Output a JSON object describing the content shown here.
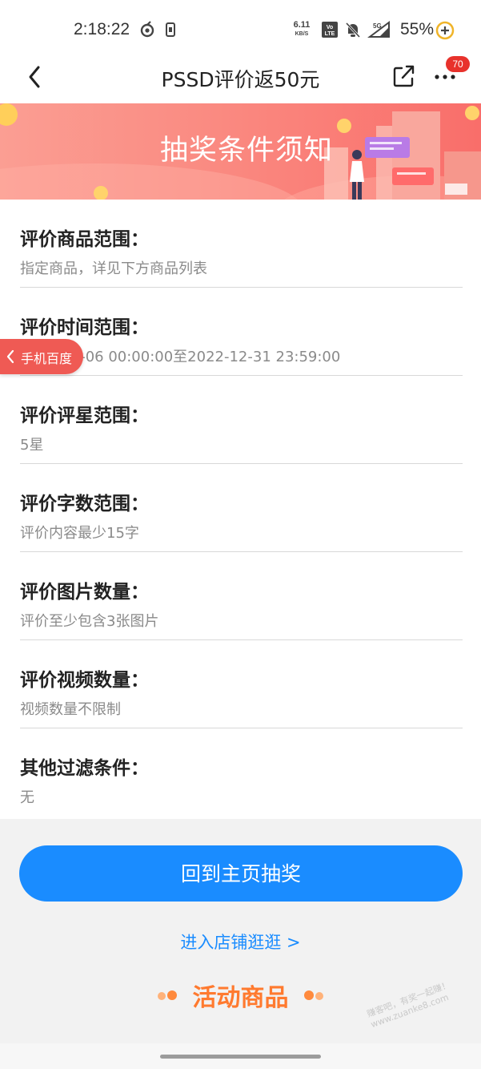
{
  "status_bar": {
    "time": "2:18:22",
    "net_speed_value": "6.11",
    "net_speed_unit": "KB/S",
    "battery": "55%"
  },
  "nav": {
    "title": "PSSD评价返50元",
    "badge_count": "70"
  },
  "banner": {
    "title": "抽奖条件须知"
  },
  "rules": [
    {
      "title": "评价商品范围：",
      "value": "指定商品，详见下方商品列表"
    },
    {
      "title": "评价时间范围：",
      "value": "2022-12-06 00:00:00至2022-12-31 23:59:00"
    },
    {
      "title": "评价评星范围：",
      "value": "5星"
    },
    {
      "title": "评价字数范围：",
      "value": "评价内容最少15字"
    },
    {
      "title": "评价图片数量：",
      "value": "评价至少包含3张图片"
    },
    {
      "title": "评价视频数量：",
      "value": "视频数量不限制"
    },
    {
      "title": "其他过滤条件：",
      "value": "无"
    }
  ],
  "floating_tag": {
    "label": "手机百度"
  },
  "bottom": {
    "main_button": "回到主页抽奖",
    "shop_link": "进入店铺逛逛 >",
    "section_title": "活动商品",
    "watermark": "赚客吧，有奖一起赚！www.zuanke8.com"
  },
  "colors": {
    "accent_blue": "#1a8cff",
    "orange": "#ff7a2f",
    "banner_red": "#f96e6a",
    "badge_red": "#e8322c"
  }
}
